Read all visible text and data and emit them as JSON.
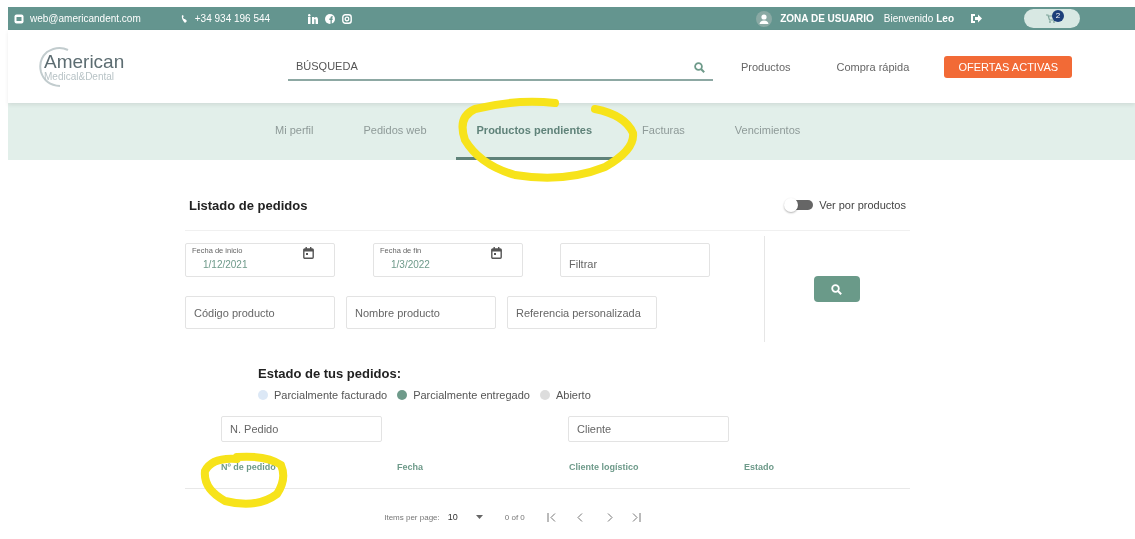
{
  "top_bar": {
    "email": "web@americandent.com",
    "phone": "+34 934 196 544",
    "user_zone": "ZONA DE USUARIO",
    "welcome": "Bienvenido",
    "user_name": "Leo",
    "cart_count": "2"
  },
  "header": {
    "logo_title": "American",
    "logo_subtitle": "Medical&Dental",
    "search": {
      "placeholder": "BÚSQUEDA"
    },
    "links": [
      "Productos",
      "Compra rápida"
    ],
    "offers_button": "OFERTAS ACTIVAS"
  },
  "tabs": [
    {
      "label": "Mi perfil",
      "selected": false
    },
    {
      "label": "Pedidos web",
      "selected": false
    },
    {
      "label": "Productos pendientes",
      "selected": true
    },
    {
      "label": "Facturas",
      "selected": false
    },
    {
      "label": "Vencimientos",
      "selected": false
    }
  ],
  "orders": {
    "title": "Listado de pedidos",
    "view_toggle": {
      "label": "Ver por productos",
      "on": false
    },
    "date_fields": [
      {
        "label": "Fecha de inicio",
        "value": "1/12/2021"
      },
      {
        "label": "Fecha de fin",
        "value": "1/3/2022"
      }
    ],
    "filter": {
      "placeholder": "Filtrar"
    },
    "product_fields": [
      {
        "placeholder": "Código producto"
      },
      {
        "placeholder": "Nombre producto"
      },
      {
        "placeholder": "Referencia personalizada"
      }
    ],
    "status_title": "Estado de tus pedidos:",
    "statuses": [
      {
        "label": "Parcialmente facturado",
        "color": "#dce8f6"
      },
      {
        "label": "Parcialmente entregado",
        "color": "#6e9a8a"
      },
      {
        "label": "Abierto",
        "color": "#dddddd"
      }
    ],
    "search_fields": [
      {
        "placeholder": "N. Pedido"
      },
      {
        "placeholder": "Cliente"
      }
    ],
    "table": {
      "columns": [
        "Nº de pedido",
        "Fecha",
        "Cliente logístico",
        "Estado"
      ]
    },
    "pagination": {
      "items_per_page_label": "Items per page:",
      "items_per_page": "10",
      "range": "0 of 0"
    }
  }
}
